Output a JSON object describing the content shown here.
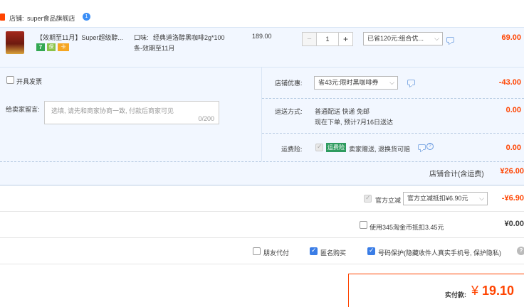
{
  "shop": {
    "label": "店铺:",
    "name": "super食品旗舰店",
    "ww_badge": "1"
  },
  "item": {
    "title": "【效期至11月】Super超级醇...",
    "spec_label": "口味:",
    "spec_value_line1": "经典道洛醇黑咖啡2g*100",
    "spec_value_line2": "条-效期至11月",
    "price": "189.00",
    "quantity": "1",
    "minus": "−",
    "plus": "+",
    "promo_select": "已省120元:组合优...",
    "total": "69.00",
    "badges": [
      "7",
      "保",
      "卡"
    ]
  },
  "invoice": {
    "label": "开具发票"
  },
  "shop_discount": {
    "label": "店铺优惠:",
    "select": "省43元:限时黑咖啡券",
    "amount": "-43.00"
  },
  "message": {
    "label": "给卖家留言:",
    "placeholder": "选填, 请先和商家协商一致, 付款后商家可见",
    "counter": "0/200"
  },
  "shipping": {
    "label": "运送方式:",
    "line1": "普通配送 快递 免邮",
    "line2": "现在下单, 预计7月16日送达",
    "amount": "0.00"
  },
  "insurance": {
    "label": "运费险:",
    "tag": "运费险",
    "text": "卖家赠送, 退换货可赔",
    "amount": "0.00"
  },
  "shop_total": {
    "label": "店铺合计(含运费)",
    "amount": "¥26.00"
  },
  "direct_discount": {
    "label": "官方立减",
    "select": "官方立减抵扣¥6.90元",
    "amount": "-¥6.90"
  },
  "taojinbi": {
    "label": "使用345淘金币抵扣3.45元",
    "amount": "¥0.00"
  },
  "options": {
    "friend_pay": "朋友代付",
    "anonymous": "匿名购买",
    "privacy": "号码保护",
    "privacy_note": "(隐藏收件人真实手机号, 保护隐私)",
    "help": "?"
  },
  "payment": {
    "label": "实付款:",
    "currency": "¥",
    "amount": "19.10"
  },
  "colors": {
    "accent_red": "#ff4400",
    "blue_bg": "#f2f7ff",
    "link_blue": "#3a7de6"
  }
}
